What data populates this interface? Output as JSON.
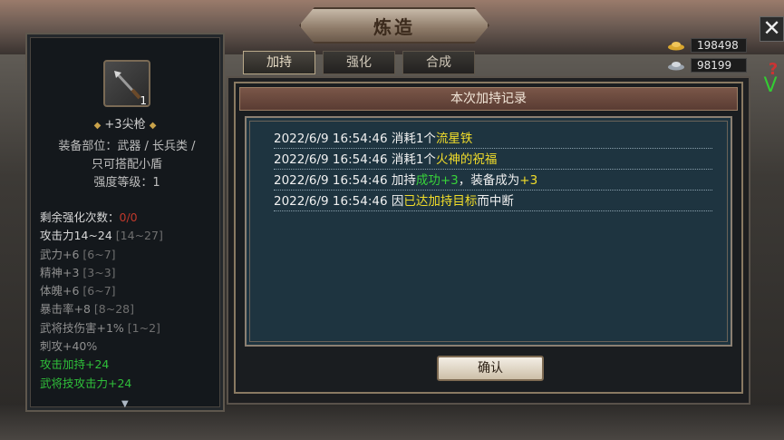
{
  "window": {
    "title": "炼造"
  },
  "top_right": {
    "gold_value": "198498",
    "silver_value": "98199",
    "close_glyph": "✕",
    "help_glyph": "?",
    "check_glyph": "V"
  },
  "item": {
    "count": "1",
    "name": "+3尖枪",
    "desc_line1": "装备部位：武器 / 长兵类 /",
    "desc_line2": "只可搭配小盾",
    "desc_line3": "强度等级：1",
    "stats": {
      "remaining_label": "剩余强化次数：",
      "remaining_value": "0/0",
      "attack_label": "攻击力14~24",
      "attack_range": "[14~27]",
      "wuli": "武力+6",
      "wuli_range": "[6~7]",
      "jingshen": "精神+3",
      "jingshen_range": "[3~3]",
      "tipo": "体魄+6",
      "tipo_range": "[6~7]",
      "baoji": "暴击率+8",
      "baoji_range": "[8~28]",
      "wujiang_skill_dmg": "武将技伤害+1%",
      "wujiang_skill_dmg_range": "[1~2]",
      "cigong": "刺攻+40%",
      "attack_bonus": "攻击加持+24",
      "wujiang_attack_bonus": "武将技攻击力+24"
    }
  },
  "tabs": [
    {
      "label": "加持",
      "active": true
    },
    {
      "label": "强化",
      "active": false
    },
    {
      "label": "合成",
      "active": false
    }
  ],
  "dialog": {
    "header": "本次加持记录",
    "log": [
      {
        "prefix": "2022/6/9 16:54:46 消耗1个",
        "highlight": "流星铁"
      },
      {
        "prefix": "2022/6/9 16:54:46 消耗1个",
        "highlight": "火神的祝福"
      },
      {
        "prefix": "2022/6/9 16:54:46 加持",
        "highlight": "成功+3",
        "middle": "，装备成为",
        "highlight2": "+3"
      },
      {
        "prefix": "2022/6/9 16:54:46 因",
        "highlight": "已达加持目标",
        "suffix": "而中断"
      }
    ],
    "confirm_label": "确认"
  },
  "colors": {
    "highlight_yellow": "#f2dd2a",
    "highlight_green": "#38d23a",
    "red_value": "#c0392b"
  }
}
